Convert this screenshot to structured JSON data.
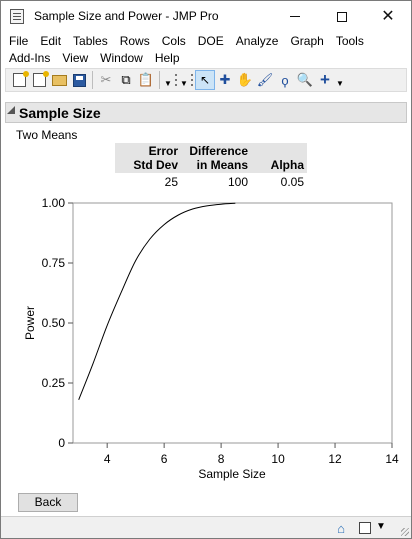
{
  "window": {
    "title": "Sample Size and Power - JMP Pro"
  },
  "menu": {
    "row1": [
      "File",
      "Edit",
      "Tables",
      "Rows",
      "Cols",
      "DOE",
      "Analyze",
      "Graph",
      "Tools"
    ],
    "row2": [
      "Add-Ins",
      "View",
      "Window",
      "Help"
    ]
  },
  "toolbar": {
    "icons": [
      "new-data-table-icon",
      "open-data-table-icon",
      "open-file-icon",
      "save-icon",
      "cut-icon",
      "copy-icon",
      "paste-icon",
      "arrow-tool-icon",
      "crosshair-tool-icon",
      "grabber-tool-icon",
      "brush-tool-icon",
      "lasso-tool-icon",
      "magnifier-tool-icon",
      "add-tool-icon"
    ]
  },
  "report": {
    "outline_title": "Sample Size",
    "subtitle": "Two Means",
    "table": {
      "headers": [
        {
          "line1": "Error",
          "line2": "Std Dev"
        },
        {
          "line1": "Difference",
          "line2": "in Means"
        },
        {
          "line1": "",
          "line2": "Alpha"
        }
      ],
      "values": [
        "25",
        "100",
        "0.05"
      ]
    }
  },
  "chart_data": {
    "type": "line",
    "title": "",
    "xlabel": "Sample Size",
    "ylabel": "Power",
    "xlim": [
      2.8,
      14
    ],
    "ylim": [
      0,
      1
    ],
    "x_ticks": [
      4,
      6,
      8,
      10,
      12,
      14
    ],
    "x_tick_labels": [
      "4",
      "6",
      "8",
      "10",
      "12",
      "14"
    ],
    "y_ticks": [
      0,
      0.25,
      0.5,
      0.75,
      1
    ],
    "y_tick_labels": [
      "0",
      "0.25",
      "0.50",
      "0.75",
      "1.00"
    ],
    "grid": false,
    "series": [
      {
        "values": [
          {
            "x": 3.0,
            "y": 0.18
          },
          {
            "x": 3.5,
            "y": 0.33
          },
          {
            "x": 4.0,
            "y": 0.49
          },
          {
            "x": 4.5,
            "y": 0.63
          },
          {
            "x": 5.0,
            "y": 0.76
          },
          {
            "x": 5.5,
            "y": 0.85
          },
          {
            "x": 6.0,
            "y": 0.91
          },
          {
            "x": 6.5,
            "y": 0.95
          },
          {
            "x": 7.0,
            "y": 0.975
          },
          {
            "x": 7.5,
            "y": 0.988
          },
          {
            "x": 8.0,
            "y": 0.995
          },
          {
            "x": 8.5,
            "y": 0.999
          }
        ]
      }
    ]
  },
  "buttons": {
    "back": "Back"
  },
  "colors": {
    "line": "#000000",
    "outline_bg": "#e6e6e6",
    "header_bg": "#e4e4e4"
  }
}
